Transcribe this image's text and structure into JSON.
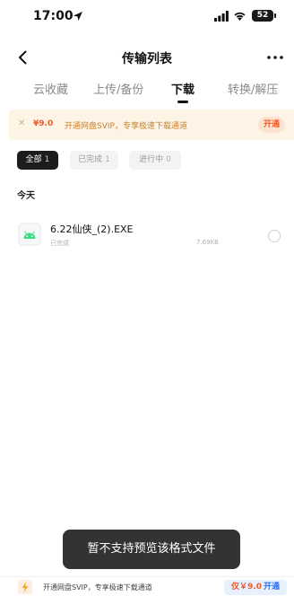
{
  "status_bar": {
    "time": "17:00",
    "battery": "52"
  },
  "nav": {
    "title": "传输列表"
  },
  "tabs": [
    {
      "label": "云收藏"
    },
    {
      "label": "上传/备份"
    },
    {
      "label": "下载",
      "active": true
    },
    {
      "label": "转换/解压"
    }
  ],
  "promo": {
    "price": "¥9.0",
    "text": "开通网盘SVIP，专享极速下载通道",
    "button": "开通"
  },
  "filters": [
    {
      "label": "全部",
      "count": "1",
      "selected": true
    },
    {
      "label": "已完成",
      "count": "1"
    },
    {
      "label": "进行中",
      "count": "0"
    }
  ],
  "section": {
    "label": "今天"
  },
  "files": [
    {
      "name": "6.22仙侠_(2).EXE",
      "status": "已完成",
      "size": "7.69KB",
      "icon": "android-file-icon"
    }
  ],
  "toast": {
    "text": "暂不支持预览该格式文件"
  },
  "bottom_banner": {
    "text": "开通网盘SVIP，专享极速下载通道",
    "cta_price": "仅￥9.0",
    "cta_open": "开通"
  },
  "colors": {
    "accent_orange": "#f05a28",
    "promo_bg": "#fdf4e6",
    "chip_selected": "#1c1c1c",
    "toast_bg": "#333335",
    "android_green": "#3ddc84"
  }
}
